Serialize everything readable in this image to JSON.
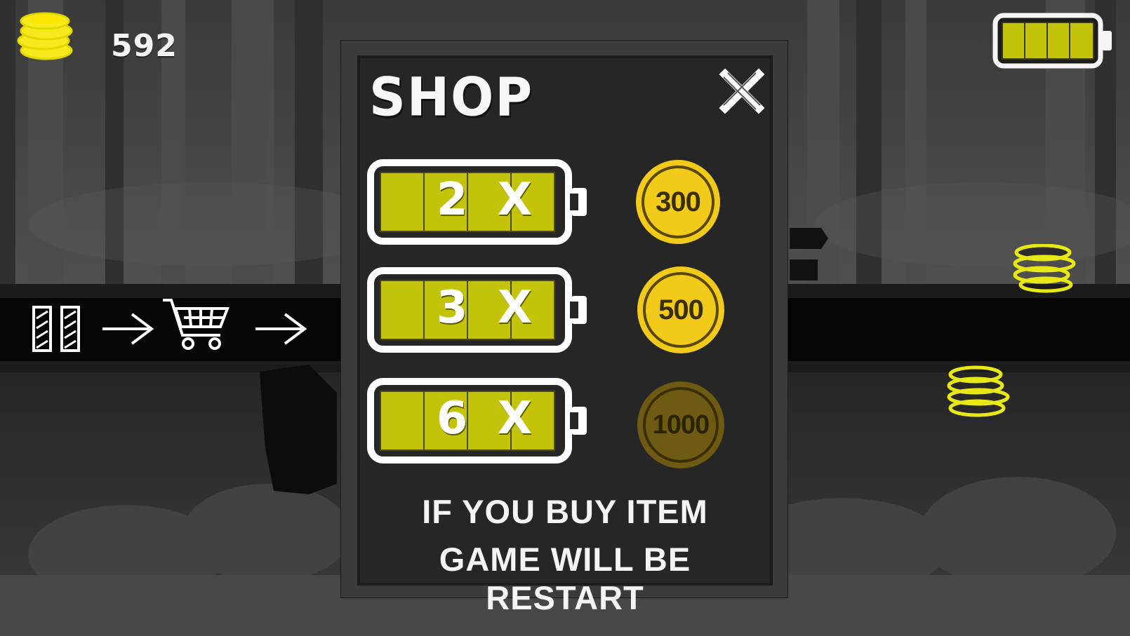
{
  "hud": {
    "coins": "592",
    "battery_level_segments": 4,
    "battery_total_segments": 4
  },
  "tutorial": {
    "icons": [
      "pause-icon",
      "arrow-right-icon",
      "shopping-cart-icon",
      "arrow-right-icon"
    ]
  },
  "shop": {
    "title": "SHOP",
    "items": [
      {
        "label": "2 X",
        "price": "300",
        "affordable": true
      },
      {
        "label": "3 X",
        "price": "500",
        "affordable": true
      },
      {
        "label": "6 X",
        "price": "1000",
        "affordable": false
      }
    ],
    "notice_line1": "IF YOU BUY ITEM",
    "notice_line2": "GAME WILL BE RESTART"
  },
  "colors": {
    "battery_fill": "#c3c30a",
    "coin_gold": "#f2cb1a",
    "coin_locked": "#6f5a14",
    "panel": "#262626"
  }
}
